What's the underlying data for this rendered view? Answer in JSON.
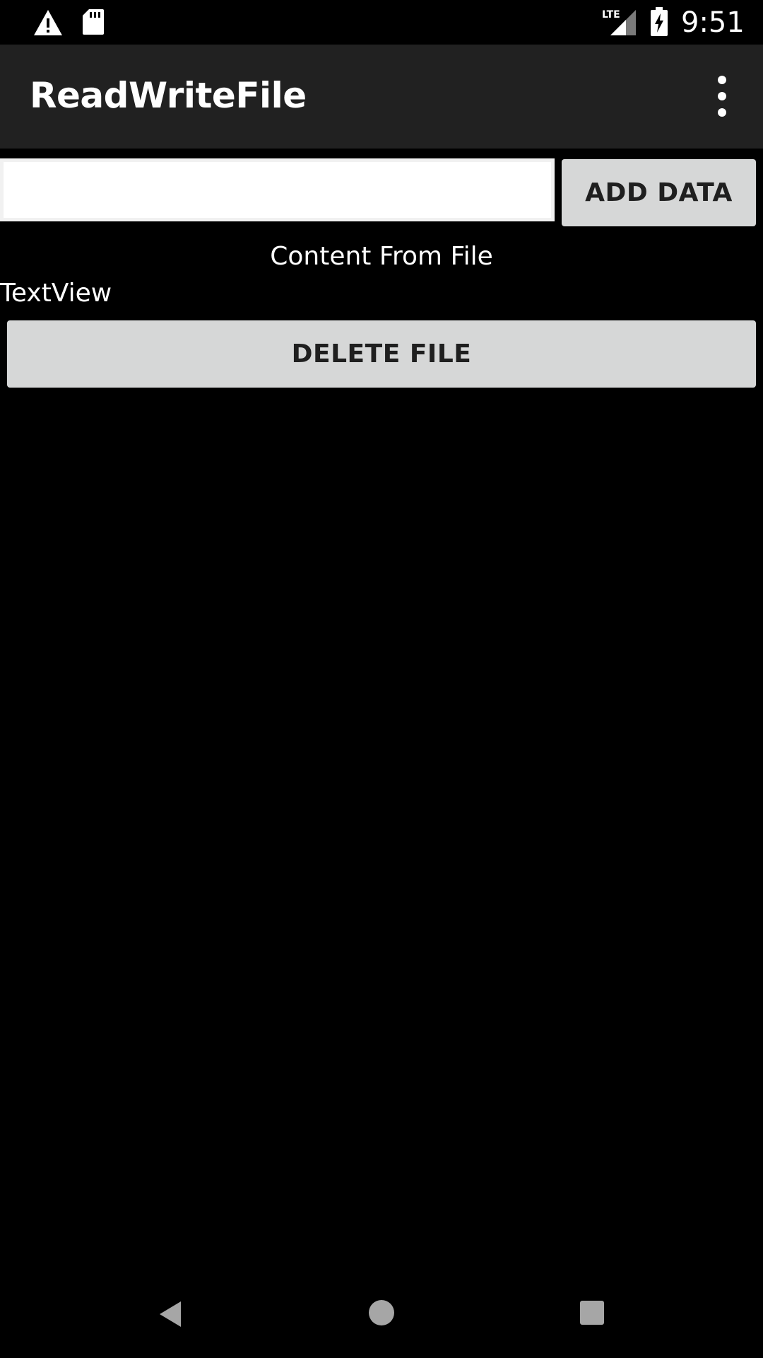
{
  "status_bar": {
    "time": "9:51",
    "network": "LTE",
    "icons": [
      "warning-icon",
      "sd-card-icon",
      "signal-icon",
      "battery-charging-icon"
    ]
  },
  "app_bar": {
    "title": "ReadWriteFile",
    "menu_icon": "more-vert-icon"
  },
  "form": {
    "input_value": "",
    "input_placeholder": "",
    "add_button_label": "ADD DATA"
  },
  "content": {
    "heading": "Content From File",
    "text_view": "TextView",
    "delete_button_label": "DELETE FILE"
  },
  "nav_bar": {
    "icons": [
      "back-icon",
      "home-icon",
      "recents-icon"
    ]
  },
  "colors": {
    "background": "#000000",
    "app_bar": "#212121",
    "button": "#d6d7d7",
    "button_text": "#1f1f1f",
    "text": "#ffffff"
  }
}
